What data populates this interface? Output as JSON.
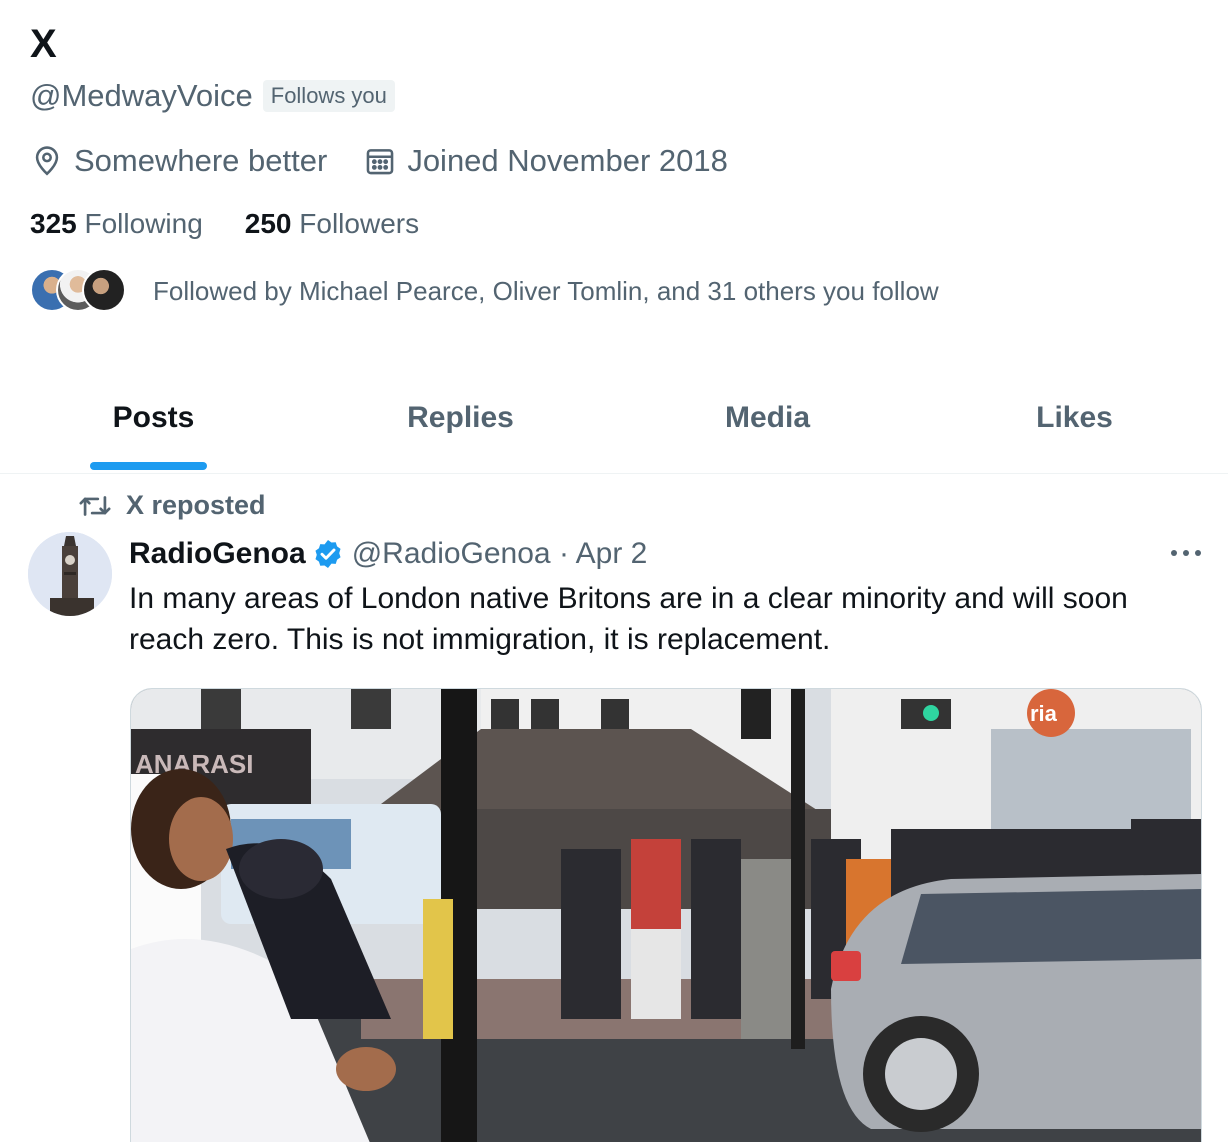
{
  "profile": {
    "display_name": "X",
    "handle": "@MedwayVoice",
    "follows_you": "Follows you",
    "location": "Somewhere better",
    "joined": "Joined November 2018",
    "following_count": "325",
    "following_label": "Following",
    "followers_count": "250",
    "followers_label": "Followers",
    "followed_by": "Followed by Michael Pearce, Oliver Tomlin, and 31 others you follow"
  },
  "tabs": [
    {
      "label": "Posts",
      "active": true
    },
    {
      "label": "Replies",
      "active": false
    },
    {
      "label": "Media",
      "active": false
    },
    {
      "label": "Likes",
      "active": false
    }
  ],
  "post": {
    "repost_label": "X reposted",
    "author_name": "RadioGenoa",
    "author_handle_date": "@RadioGenoa · Apr 2",
    "text": "In many areas of London native Britons are in a clear minority and will soon reach zero. This is not immigration, it is replacement.",
    "image_shop_sign": "ANARASI",
    "image_logo": "ria"
  },
  "colors": {
    "accent": "#1d9bf0",
    "secondary_text": "#536471",
    "primary_text": "#0f1419"
  },
  "icons": {
    "location": "location-pin-icon",
    "calendar": "calendar-icon",
    "repost": "repost-icon",
    "verified": "verified-badge-icon",
    "more": "more-options-icon"
  }
}
